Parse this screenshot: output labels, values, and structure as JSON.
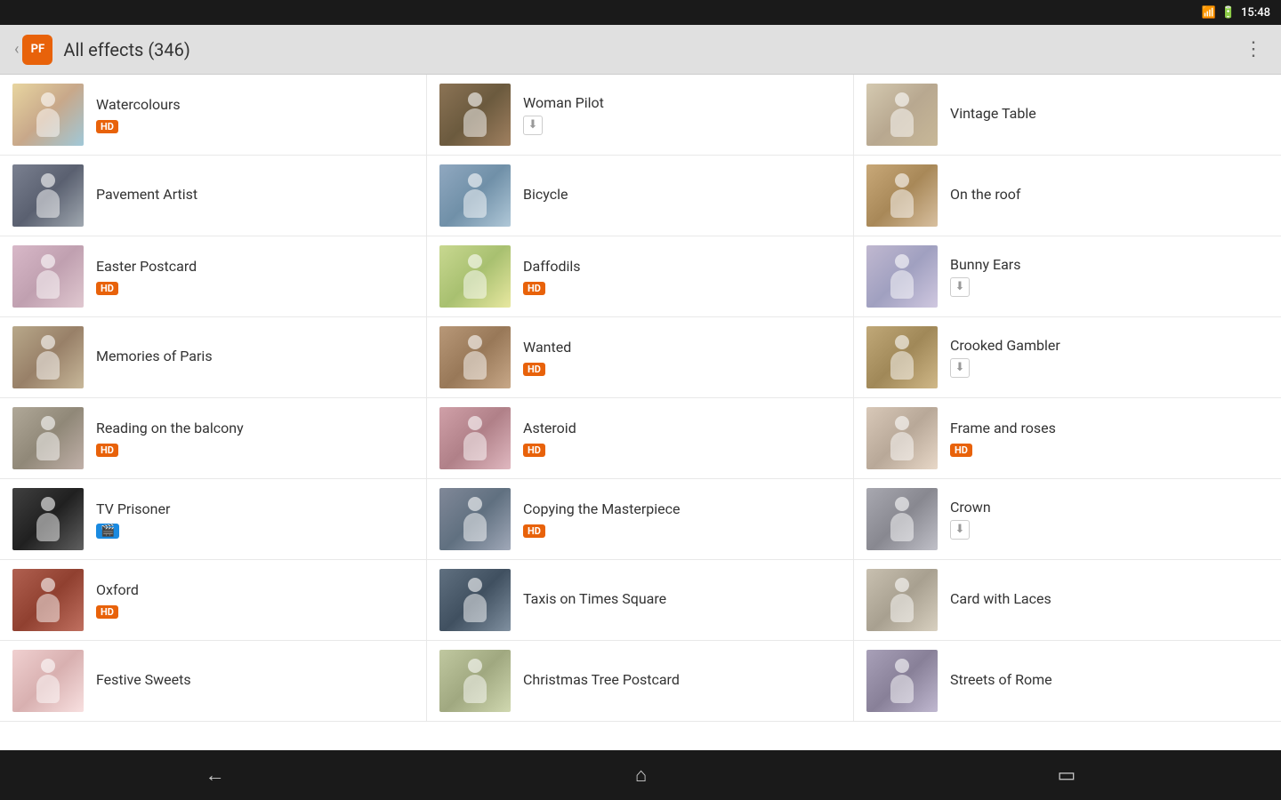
{
  "status_bar": {
    "time": "15:48"
  },
  "top_bar": {
    "logo": "PF",
    "title": "All effects",
    "count": "(346)",
    "menu_icon": "⋮"
  },
  "grid_items": [
    {
      "id": "watercolours",
      "name": "Watercolours",
      "badge": "hd",
      "thumb_class": "thumb-watercolours"
    },
    {
      "id": "woman-pilot",
      "name": "Woman Pilot",
      "badge": "download",
      "thumb_class": "thumb-woman-pilot"
    },
    {
      "id": "vintage-table",
      "name": "Vintage Table",
      "badge": "",
      "thumb_class": "thumb-vintage-table"
    },
    {
      "id": "pavement-artist",
      "name": "Pavement Artist",
      "badge": "",
      "thumb_class": "thumb-pavement-artist"
    },
    {
      "id": "bicycle",
      "name": "Bicycle",
      "badge": "",
      "thumb_class": "thumb-bicycle"
    },
    {
      "id": "on-the-roof",
      "name": "On the roof",
      "badge": "",
      "thumb_class": "thumb-on-roof"
    },
    {
      "id": "easter-postcard",
      "name": "Easter Postcard",
      "badge": "hd",
      "thumb_class": "thumb-easter"
    },
    {
      "id": "daffodils",
      "name": "Daffodils",
      "badge": "hd",
      "thumb_class": "thumb-daffodils"
    },
    {
      "id": "bunny-ears",
      "name": "Bunny Ears",
      "badge": "download",
      "thumb_class": "thumb-bunny"
    },
    {
      "id": "memories-of-paris",
      "name": "Memories of Paris",
      "badge": "",
      "thumb_class": "thumb-memories"
    },
    {
      "id": "wanted",
      "name": "Wanted",
      "badge": "hd",
      "thumb_class": "thumb-wanted"
    },
    {
      "id": "crooked-gambler",
      "name": "Crooked Gambler",
      "badge": "download",
      "thumb_class": "thumb-crooked"
    },
    {
      "id": "reading-balcony",
      "name": "Reading on the balcony",
      "badge": "hd",
      "thumb_class": "thumb-balcony"
    },
    {
      "id": "asteroid",
      "name": "Asteroid",
      "badge": "hd",
      "thumb_class": "thumb-asteroid"
    },
    {
      "id": "frame-roses",
      "name": "Frame and roses",
      "badge": "hd",
      "thumb_class": "thumb-frame"
    },
    {
      "id": "tv-prisoner",
      "name": "TV Prisoner",
      "badge": "video",
      "thumb_class": "thumb-tv"
    },
    {
      "id": "copying-masterpiece",
      "name": "Copying the Masterpiece",
      "badge": "hd",
      "thumb_class": "thumb-copying"
    },
    {
      "id": "crown",
      "name": "Crown",
      "badge": "download",
      "thumb_class": "thumb-crown"
    },
    {
      "id": "oxford",
      "name": "Oxford",
      "badge": "hd",
      "thumb_class": "thumb-oxford"
    },
    {
      "id": "taxis-times-square",
      "name": "Taxis on Times Square",
      "badge": "",
      "thumb_class": "thumb-taxis"
    },
    {
      "id": "card-with-laces",
      "name": "Card with Laces",
      "badge": "",
      "thumb_class": "thumb-card"
    },
    {
      "id": "festive-sweets",
      "name": "Festive Sweets",
      "badge": "",
      "thumb_class": "thumb-festive"
    },
    {
      "id": "christmas-tree-postcard",
      "name": "Christmas Tree Postcard",
      "badge": "",
      "thumb_class": "thumb-christmas"
    },
    {
      "id": "streets-of-rome",
      "name": "Streets of Rome",
      "badge": "",
      "thumb_class": "thumb-streets"
    }
  ],
  "bottom_nav": {
    "back_icon": "←",
    "home_icon": "⌂",
    "recents_icon": "▭"
  }
}
